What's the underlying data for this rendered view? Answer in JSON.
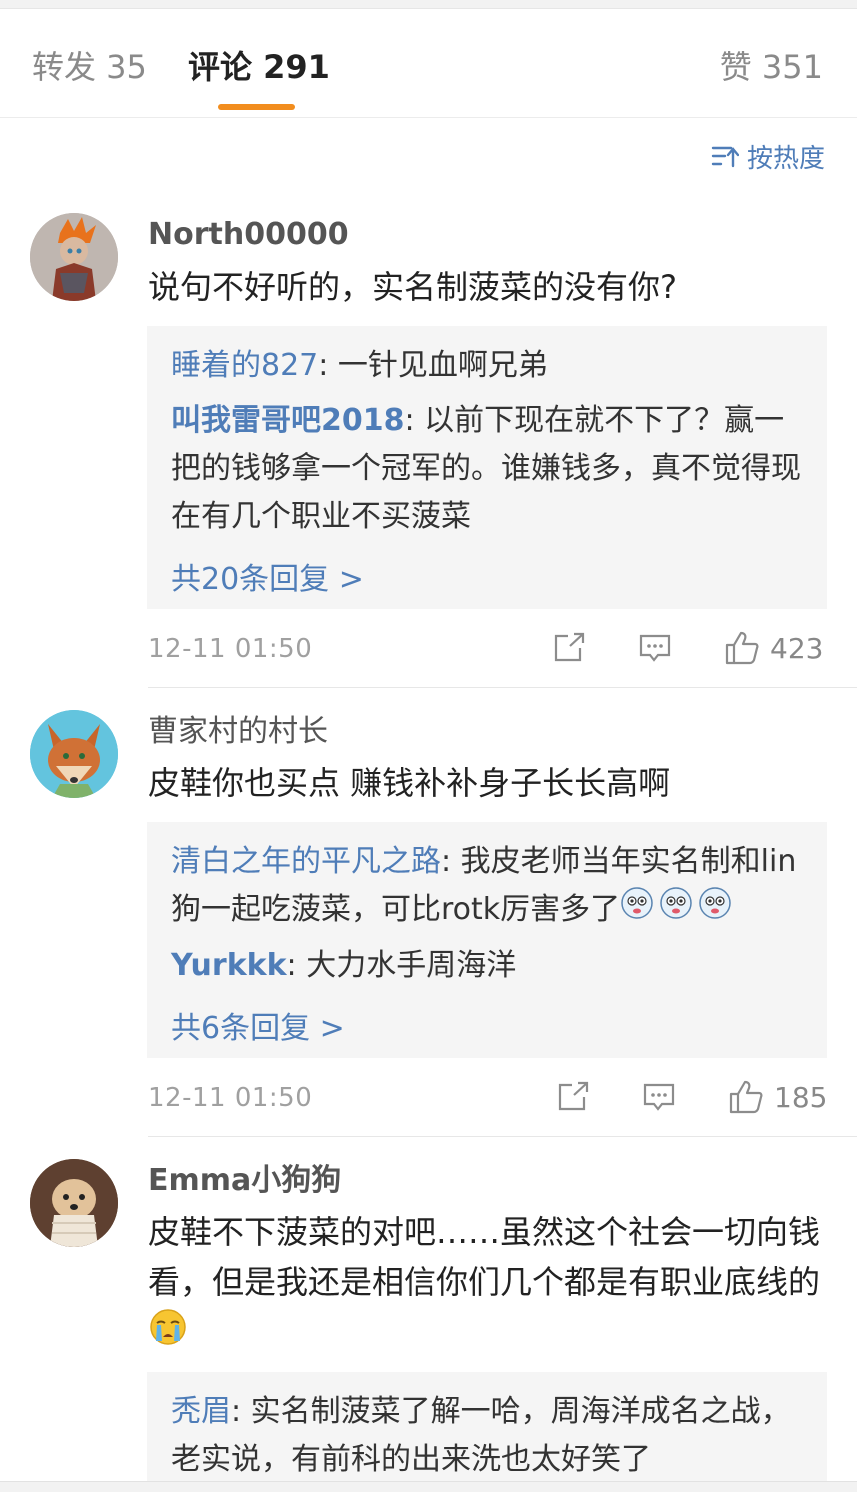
{
  "tabs": {
    "repost": "转发 35",
    "comment": "评论 291",
    "like": "赞 351"
  },
  "sort": {
    "label": "按热度",
    "icon": "sort-icon"
  },
  "colors": {
    "accent": "#f28d1e",
    "link": "#4f7db8"
  },
  "comments": [
    {
      "username": "North00000",
      "text": "说句不好听的，实名制菠菜的没有你?",
      "replies": [
        {
          "user": "睡着的827",
          "sep": ": ",
          "text": "一针见血啊兄弟"
        },
        {
          "user": "叫我雷哥吧2018",
          "sep": ": ",
          "text": "以前下现在就不下了？赢一把的钱够拿一个冠军的。谁嫌钱多，真不觉得现在有几个职业不买菠菜"
        }
      ],
      "more": "共20条回复 >",
      "time": "12-11 01:50",
      "likes": "423"
    },
    {
      "username": "曹家村的村长",
      "text": "皮鞋你也买点 赚钱补补身子长长高啊",
      "replies": [
        {
          "user": "清白之年的平凡之路",
          "sep": ": ",
          "text": "我皮老师当年实名制和lin狗一起吃菠菜，可比rotk厉害多了"
        },
        {
          "user": "Yurkkk",
          "sep": ": ",
          "text": "大力水手周海洋"
        }
      ],
      "more": "共6条回复 >",
      "time": "12-11 01:50",
      "likes": "185"
    },
    {
      "username": "Emma小狗狗",
      "text": "皮鞋不下菠菜的对吧……虽然这个社会一切向钱看，但是我还是相信你们几个都是有职业底线的",
      "replies": [
        {
          "user": "秃眉",
          "sep": ": ",
          "text": "实名制菠菜了解一哈，周海洋成名之战，老实说，有前科的出来洗也太好笑了"
        }
      ]
    }
  ]
}
